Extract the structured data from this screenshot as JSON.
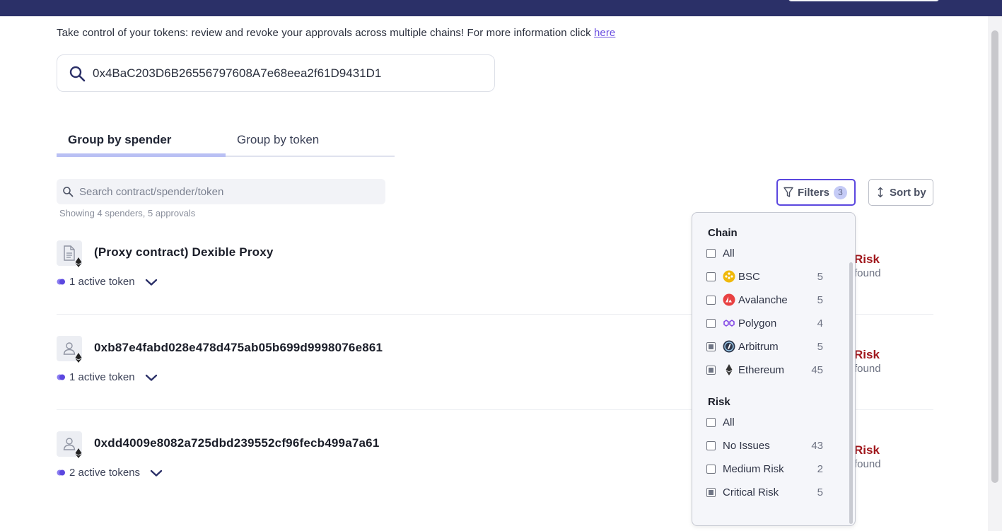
{
  "intro": {
    "text": "Take control of your tokens: review and revoke your approvals across multiple chains! For more information click ",
    "link": "here"
  },
  "address": "0x4BaC203D6B26556797608A7e68eea2f61D9431D1",
  "tabs": [
    {
      "label": "Group by spender",
      "active": true
    },
    {
      "label": "Group by token",
      "active": false
    }
  ],
  "search": {
    "placeholder": "Search contract/spender/token"
  },
  "showing": "Showing 4 spenders, 5 approvals",
  "toolbar": {
    "filters_label": "Filters",
    "filters_count": "3",
    "sort_label": "Sort by"
  },
  "spenders": [
    {
      "name": "(Proxy contract) Dexible Proxy",
      "icon": "document-icon",
      "active": "1 active token",
      "risk": "Risk",
      "found": "found"
    },
    {
      "name": "0xb87e4fabd028e478d475ab05b699d9998076e861",
      "icon": "person-icon",
      "active": "1 active token",
      "risk": "Risk",
      "found": "found"
    },
    {
      "name": "0xdd4009e8082a725dbd239552cf96fecb499a7a61",
      "icon": "person-icon",
      "active": "2 active tokens",
      "risk": "Risk",
      "found": "found"
    }
  ],
  "filters": {
    "chain_title": "Chain",
    "chains": [
      {
        "label": "All",
        "count": "",
        "checked": false,
        "icon": ""
      },
      {
        "label": "BSC",
        "count": "5",
        "checked": false,
        "icon": "bsc-icon",
        "color": "#f0b90b"
      },
      {
        "label": "Avalanche",
        "count": "5",
        "checked": false,
        "icon": "avalanche-icon",
        "color": "#e84142"
      },
      {
        "label": "Polygon",
        "count": "4",
        "checked": false,
        "icon": "polygon-icon",
        "color": "#8247e5"
      },
      {
        "label": "Arbitrum",
        "count": "5",
        "checked": true,
        "icon": "arbitrum-icon",
        "color": "#2d374b"
      },
      {
        "label": "Ethereum",
        "count": "45",
        "checked": true,
        "icon": "ethereum-icon",
        "color": "#343434"
      }
    ],
    "risk_title": "Risk",
    "risks": [
      {
        "label": "All",
        "count": "",
        "checked": false
      },
      {
        "label": "No Issues",
        "count": "43",
        "checked": false
      },
      {
        "label": "Medium Risk",
        "count": "2",
        "checked": false
      },
      {
        "label": "Critical Risk",
        "count": "5",
        "checked": true
      }
    ]
  },
  "colors": {
    "topbar": "#2b3068",
    "accent": "#5b47df",
    "risk": "#a0161b"
  }
}
